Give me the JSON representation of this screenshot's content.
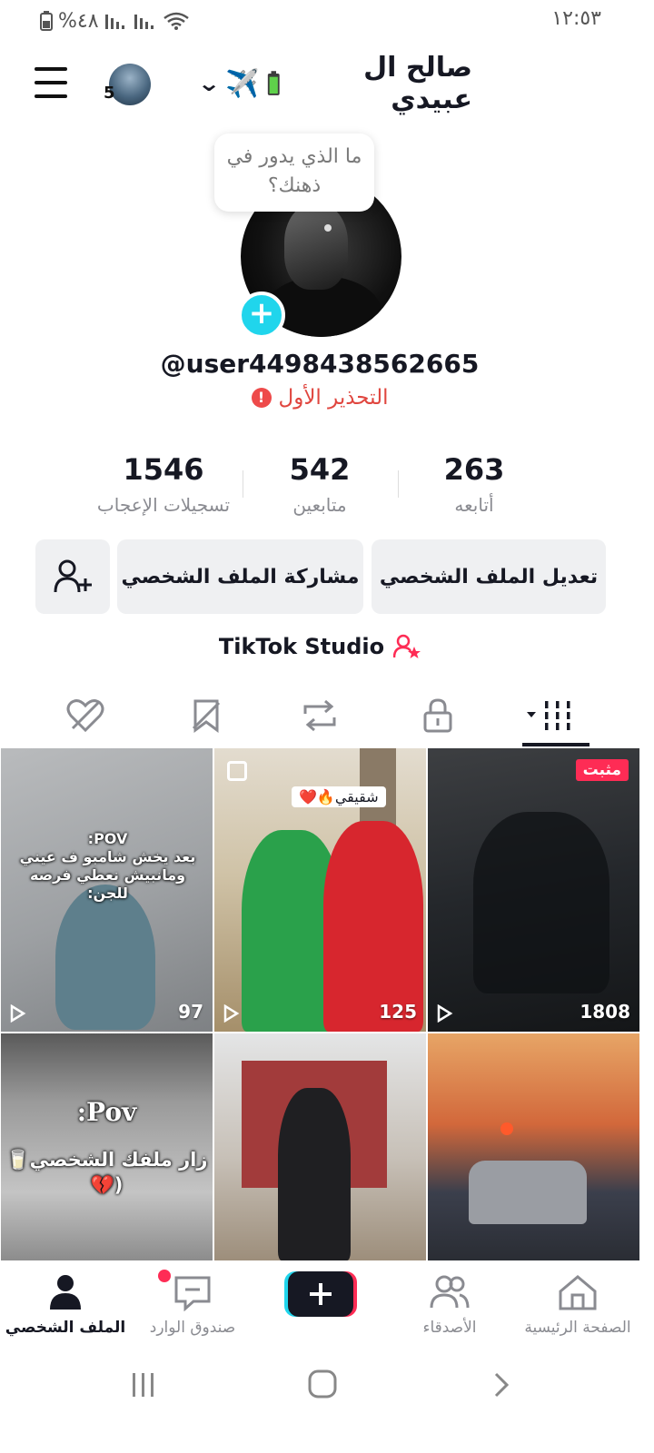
{
  "status_bar": {
    "battery": "%٤٨",
    "time": "١٢:٥٣"
  },
  "header": {
    "avatar_count": "5",
    "profile_name": "صالح ال عبيدي"
  },
  "bubble_text": "ما الذي يدور في ذهنك؟",
  "username": "@user4498438562665",
  "warning": "التحذير الأول",
  "stats": [
    {
      "value": "263",
      "label": "أتابعه"
    },
    {
      "value": "542",
      "label": "متابعين"
    },
    {
      "value": "1546",
      "label": "تسجيلات الإعجاب"
    }
  ],
  "buttons": {
    "edit": "تعديل الملف الشخصي",
    "share": "مشاركة الملف الشخصي"
  },
  "studio": "TikTok Studio",
  "videos": [
    {
      "views": "1808",
      "pinned": "مثبت"
    },
    {
      "views": "125",
      "sticker": "شقيقي🔥❤️"
    },
    {
      "views": "97",
      "pov": "POV:",
      "caption": "بعد يخش شامبو ف عيني ومانبيش نعطي فرصه للجن:"
    },
    {
      "pov": "Pov:",
      "caption": "زار ملفك الشخصي🥛 (💔"
    }
  ],
  "nav": {
    "home": "الصفحة الرئيسية",
    "friends": "الأصدقاء",
    "inbox": "صندوق الوارد",
    "profile": "الملف الشخصي"
  },
  "colors": {
    "accent": "#fe2c55",
    "cyan": "#20d5ec",
    "warning": "#e0463f"
  }
}
